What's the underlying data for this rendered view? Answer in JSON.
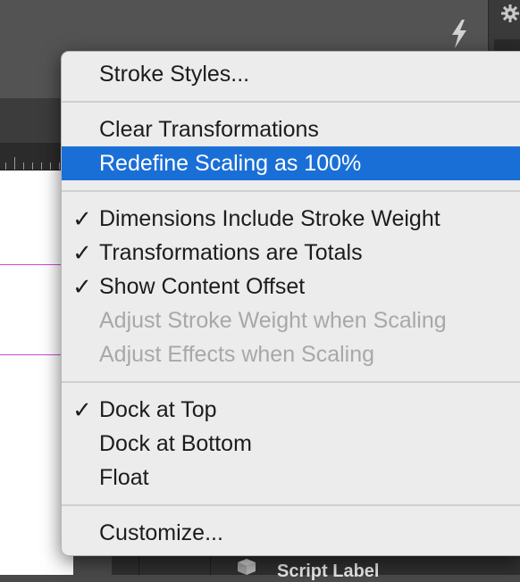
{
  "menu": {
    "items": [
      {
        "label": "Stroke Styles...",
        "checked": false,
        "enabled": true,
        "highlighted": false
      },
      {
        "label": "Clear Transformations",
        "checked": false,
        "enabled": true,
        "highlighted": false
      },
      {
        "label": "Redefine Scaling as 100%",
        "checked": false,
        "enabled": true,
        "highlighted": true
      },
      {
        "label": "Dimensions Include Stroke Weight",
        "checked": true,
        "enabled": true,
        "highlighted": false
      },
      {
        "label": "Transformations are Totals",
        "checked": true,
        "enabled": true,
        "highlighted": false
      },
      {
        "label": "Show Content Offset",
        "checked": true,
        "enabled": true,
        "highlighted": false
      },
      {
        "label": "Adjust Stroke Weight when Scaling",
        "checked": false,
        "enabled": false,
        "highlighted": false
      },
      {
        "label": "Adjust Effects when Scaling",
        "checked": false,
        "enabled": false,
        "highlighted": false
      },
      {
        "label": "Dock at Top",
        "checked": true,
        "enabled": true,
        "highlighted": false
      },
      {
        "label": "Dock at Bottom",
        "checked": false,
        "enabled": true,
        "highlighted": false
      },
      {
        "label": "Float",
        "checked": false,
        "enabled": true,
        "highlighted": false
      },
      {
        "label": "Customize...",
        "checked": false,
        "enabled": true,
        "highlighted": false
      }
    ],
    "check_glyph": "✓",
    "highlight_color": "#1a6fd6"
  },
  "background": {
    "script_label": "Script Label",
    "icons": [
      "gear-icon",
      "lightning-bolt-icon",
      "script-label-icon"
    ],
    "guide_color": "#c84bd0"
  }
}
